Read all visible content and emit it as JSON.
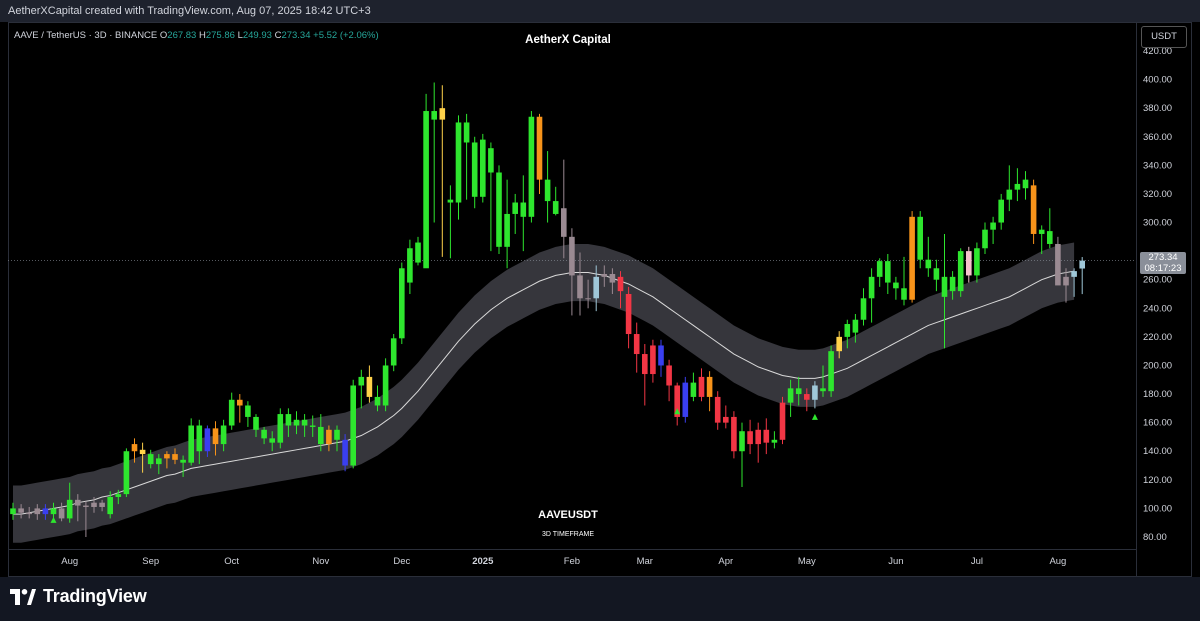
{
  "header": {
    "created_text": "AetherXCapital created with TradingView.com, Aug 07, 2025 18:42 UTC+3"
  },
  "legend": {
    "symbol": "AAVE / TetherUS · 3D · BINANCE",
    "o_label": "O",
    "o_value": "267.83",
    "h_label": "H",
    "h_value": "275.86",
    "l_label": "L",
    "l_value": "249.93",
    "c_label": "C",
    "c_value": "273.34",
    "change": "+5.52 (+2.06%)"
  },
  "watermark": {
    "title": "AetherX Capital",
    "symbol": "AAVEUSDT",
    "timeframe": "3D TIMEFRAME"
  },
  "axis": {
    "unit_button": "USDT",
    "current_price": "273.34",
    "countdown": "08:17:23"
  },
  "brand": {
    "name": "TradingView"
  },
  "colors": {
    "background": "#000000",
    "band_fill": "#3f4046",
    "band_line": "#d9d9d9",
    "bull_green": "#2ee62e",
    "bear_red": "#f23645",
    "orange": "#f7931a",
    "yellow": "#ffd24a",
    "blue": "#3a3ff0",
    "gray": "#9a8a92",
    "light_blue": "#9fc7d8",
    "text": "#d1d4dc"
  },
  "chart_data": {
    "type": "candlestick",
    "symbol": "AAVE / TetherUS",
    "ylim": [
      75,
      430
    ],
    "y_ticks": [
      80,
      100,
      120,
      140,
      160,
      180,
      200,
      220,
      240,
      260,
      280,
      300,
      320,
      340,
      360,
      380,
      400,
      420
    ],
    "y_tick_labels": [
      "80.00",
      "100.00",
      "120.00",
      "140.00",
      "160.00",
      "180.00",
      "200.00",
      "220.00",
      "240.00",
      "260.00",
      "280.00",
      "300.00",
      "320.00",
      "340.00",
      "360.00",
      "380.00",
      "400.00",
      "420.00"
    ],
    "x_ticks": [
      {
        "label": "Aug",
        "index": 7
      },
      {
        "label": "Sep",
        "index": 17
      },
      {
        "label": "Oct",
        "index": 27
      },
      {
        "label": "Nov",
        "index": 38
      },
      {
        "label": "Dec",
        "index": 48
      },
      {
        "label": "2025",
        "index": 58
      },
      {
        "label": "Feb",
        "index": 69
      },
      {
        "label": "Mar",
        "index": 78
      },
      {
        "label": "Apr",
        "index": 88
      },
      {
        "label": "May",
        "index": 98
      },
      {
        "label": "Jun",
        "index": 109
      },
      {
        "label": "Jul",
        "index": 119
      },
      {
        "label": "Aug",
        "index": 129
      }
    ],
    "candles": [
      {
        "o": 96,
        "h": 104,
        "l": 92,
        "c": 100,
        "col": "green"
      },
      {
        "o": 100,
        "h": 103,
        "l": 93,
        "c": 97,
        "col": "gray"
      },
      {
        "o": 97,
        "h": 101,
        "l": 93,
        "c": 96,
        "col": "gray"
      },
      {
        "o": 96,
        "h": 103,
        "l": 92,
        "c": 100,
        "col": "gray"
      },
      {
        "o": 100,
        "h": 103,
        "l": 92,
        "c": 96,
        "col": "blue"
      },
      {
        "o": 96,
        "h": 104,
        "l": 92,
        "c": 100,
        "col": "green"
      },
      {
        "o": 100,
        "h": 104,
        "l": 91,
        "c": 93,
        "col": "gray"
      },
      {
        "o": 93,
        "h": 118,
        "l": 90,
        "c": 106,
        "col": "green"
      },
      {
        "o": 106,
        "h": 110,
        "l": 91,
        "c": 102,
        "col": "gray"
      },
      {
        "o": 102,
        "h": 105,
        "l": 80,
        "c": 101,
        "col": "gray"
      },
      {
        "o": 101,
        "h": 108,
        "l": 97,
        "c": 104,
        "col": "gray"
      },
      {
        "o": 104,
        "h": 106,
        "l": 98,
        "c": 101,
        "col": "gray"
      },
      {
        "o": 96,
        "h": 112,
        "l": 93,
        "c": 108,
        "col": "green"
      },
      {
        "o": 108,
        "h": 113,
        "l": 103,
        "c": 110,
        "col": "green"
      },
      {
        "o": 110,
        "h": 142,
        "l": 108,
        "c": 140,
        "col": "green"
      },
      {
        "o": 140,
        "h": 149,
        "l": 132,
        "c": 145,
        "col": "orange"
      },
      {
        "o": 141,
        "h": 146,
        "l": 125,
        "c": 138,
        "col": "yellow"
      },
      {
        "o": 138,
        "h": 141,
        "l": 128,
        "c": 131,
        "col": "green"
      },
      {
        "o": 131,
        "h": 138,
        "l": 124,
        "c": 135,
        "col": "green"
      },
      {
        "o": 135,
        "h": 140,
        "l": 128,
        "c": 138,
        "col": "orange"
      },
      {
        "o": 138,
        "h": 142,
        "l": 131,
        "c": 134,
        "col": "orange"
      },
      {
        "o": 134,
        "h": 137,
        "l": 122,
        "c": 132,
        "col": "green"
      },
      {
        "o": 132,
        "h": 163,
        "l": 130,
        "c": 158,
        "col": "green"
      },
      {
        "o": 158,
        "h": 162,
        "l": 131,
        "c": 140,
        "col": "green"
      },
      {
        "o": 140,
        "h": 158,
        "l": 136,
        "c": 156,
        "col": "blue"
      },
      {
        "o": 156,
        "h": 161,
        "l": 137,
        "c": 145,
        "col": "orange"
      },
      {
        "o": 145,
        "h": 162,
        "l": 140,
        "c": 158,
        "col": "green"
      },
      {
        "o": 158,
        "h": 181,
        "l": 155,
        "c": 176,
        "col": "green"
      },
      {
        "o": 176,
        "h": 180,
        "l": 160,
        "c": 172,
        "col": "orange"
      },
      {
        "o": 172,
        "h": 175,
        "l": 157,
        "c": 164,
        "col": "green"
      },
      {
        "o": 164,
        "h": 166,
        "l": 150,
        "c": 155,
        "col": "green"
      },
      {
        "o": 155,
        "h": 157,
        "l": 145,
        "c": 149,
        "col": "green"
      },
      {
        "o": 149,
        "h": 154,
        "l": 140,
        "c": 146,
        "col": "green"
      },
      {
        "o": 146,
        "h": 170,
        "l": 142,
        "c": 166,
        "col": "green"
      },
      {
        "o": 166,
        "h": 170,
        "l": 150,
        "c": 158,
        "col": "green"
      },
      {
        "o": 158,
        "h": 168,
        "l": 152,
        "c": 162,
        "col": "green"
      },
      {
        "o": 162,
        "h": 166,
        "l": 150,
        "c": 158,
        "col": "green"
      },
      {
        "o": 158,
        "h": 165,
        "l": 150,
        "c": 157,
        "col": "green"
      },
      {
        "o": 157,
        "h": 166,
        "l": 140,
        "c": 145,
        "col": "green"
      },
      {
        "o": 145,
        "h": 158,
        "l": 140,
        "c": 155,
        "col": "orange"
      },
      {
        "o": 155,
        "h": 158,
        "l": 140,
        "c": 148,
        "col": "green"
      },
      {
        "o": 148,
        "h": 152,
        "l": 126,
        "c": 130,
        "col": "blue"
      },
      {
        "o": 130,
        "h": 190,
        "l": 128,
        "c": 186,
        "col": "green"
      },
      {
        "o": 186,
        "h": 197,
        "l": 170,
        "c": 192,
        "col": "green"
      },
      {
        "o": 192,
        "h": 200,
        "l": 174,
        "c": 178,
        "col": "yellow"
      },
      {
        "o": 178,
        "h": 186,
        "l": 168,
        "c": 172,
        "col": "green"
      },
      {
        "o": 172,
        "h": 205,
        "l": 168,
        "c": 200,
        "col": "green"
      },
      {
        "o": 200,
        "h": 222,
        "l": 196,
        "c": 219,
        "col": "green"
      },
      {
        "o": 219,
        "h": 272,
        "l": 215,
        "c": 268,
        "col": "green"
      },
      {
        "o": 258,
        "h": 288,
        "l": 250,
        "c": 282,
        "col": "green"
      },
      {
        "o": 272,
        "h": 290,
        "l": 270,
        "c": 286,
        "col": "green"
      },
      {
        "o": 268,
        "h": 390,
        "l": 270,
        "c": 378,
        "col": "green"
      },
      {
        "o": 378,
        "h": 398,
        "l": 300,
        "c": 372,
        "col": "green"
      },
      {
        "o": 372,
        "h": 396,
        "l": 276,
        "c": 380,
        "col": "yellow"
      },
      {
        "o": 316,
        "h": 326,
        "l": 275,
        "c": 314,
        "col": "green"
      },
      {
        "o": 314,
        "h": 375,
        "l": 302,
        "c": 370,
        "col": "green"
      },
      {
        "o": 370,
        "h": 376,
        "l": 316,
        "c": 356,
        "col": "green"
      },
      {
        "o": 356,
        "h": 360,
        "l": 310,
        "c": 318,
        "col": "green"
      },
      {
        "o": 318,
        "h": 362,
        "l": 314,
        "c": 358,
        "col": "green"
      },
      {
        "o": 352,
        "h": 356,
        "l": 280,
        "c": 335,
        "col": "green"
      },
      {
        "o": 335,
        "h": 340,
        "l": 278,
        "c": 283,
        "col": "green"
      },
      {
        "o": 283,
        "h": 330,
        "l": 268,
        "c": 306,
        "col": "green"
      },
      {
        "o": 306,
        "h": 320,
        "l": 292,
        "c": 314,
        "col": "green"
      },
      {
        "o": 314,
        "h": 333,
        "l": 280,
        "c": 304,
        "col": "green"
      },
      {
        "o": 304,
        "h": 378,
        "l": 300,
        "c": 374,
        "col": "green"
      },
      {
        "o": 374,
        "h": 376,
        "l": 320,
        "c": 330,
        "col": "orange"
      },
      {
        "o": 330,
        "h": 350,
        "l": 300,
        "c": 315,
        "col": "green"
      },
      {
        "o": 315,
        "h": 325,
        "l": 305,
        "c": 306,
        "col": "green"
      },
      {
        "o": 310,
        "h": 344,
        "l": 275,
        "c": 290,
        "col": "gray"
      },
      {
        "o": 290,
        "h": 296,
        "l": 235,
        "c": 263,
        "col": "gray"
      },
      {
        "o": 263,
        "h": 279,
        "l": 235,
        "c": 247,
        "col": "gray"
      },
      {
        "o": 247,
        "h": 260,
        "l": 240,
        "c": 247,
        "col": "gray"
      },
      {
        "o": 247,
        "h": 270,
        "l": 238,
        "c": 262,
        "col": "light_blue"
      },
      {
        "o": 262,
        "h": 270,
        "l": 255,
        "c": 264,
        "col": "gray"
      },
      {
        "o": 264,
        "h": 268,
        "l": 250,
        "c": 258,
        "col": "gray"
      },
      {
        "o": 262,
        "h": 266,
        "l": 240,
        "c": 252,
        "col": "red"
      },
      {
        "o": 250,
        "h": 255,
        "l": 212,
        "c": 222,
        "col": "red"
      },
      {
        "o": 222,
        "h": 230,
        "l": 195,
        "c": 208,
        "col": "red"
      },
      {
        "o": 208,
        "h": 215,
        "l": 172,
        "c": 194,
        "col": "red"
      },
      {
        "o": 194,
        "h": 218,
        "l": 188,
        "c": 214,
        "col": "red"
      },
      {
        "o": 214,
        "h": 218,
        "l": 192,
        "c": 200,
        "col": "blue"
      },
      {
        "o": 200,
        "h": 204,
        "l": 175,
        "c": 186,
        "col": "red"
      },
      {
        "o": 186,
        "h": 188,
        "l": 158,
        "c": 164,
        "col": "red"
      },
      {
        "o": 164,
        "h": 192,
        "l": 160,
        "c": 188,
        "col": "blue"
      },
      {
        "o": 188,
        "h": 195,
        "l": 175,
        "c": 178,
        "col": "green"
      },
      {
        "o": 178,
        "h": 198,
        "l": 175,
        "c": 192,
        "col": "red"
      },
      {
        "o": 192,
        "h": 196,
        "l": 168,
        "c": 178,
        "col": "orange"
      },
      {
        "o": 178,
        "h": 182,
        "l": 155,
        "c": 160,
        "col": "red"
      },
      {
        "o": 160,
        "h": 172,
        "l": 156,
        "c": 164,
        "col": "red"
      },
      {
        "o": 164,
        "h": 168,
        "l": 135,
        "c": 140,
        "col": "red"
      },
      {
        "o": 140,
        "h": 160,
        "l": 115,
        "c": 154,
        "col": "green"
      },
      {
        "o": 154,
        "h": 162,
        "l": 138,
        "c": 145,
        "col": "red"
      },
      {
        "o": 145,
        "h": 160,
        "l": 132,
        "c": 155,
        "col": "red"
      },
      {
        "o": 155,
        "h": 163,
        "l": 138,
        "c": 146,
        "col": "red"
      },
      {
        "o": 146,
        "h": 154,
        "l": 142,
        "c": 148,
        "col": "green"
      },
      {
        "o": 148,
        "h": 178,
        "l": 145,
        "c": 174,
        "col": "red"
      },
      {
        "o": 174,
        "h": 190,
        "l": 164,
        "c": 184,
        "col": "green"
      },
      {
        "o": 184,
        "h": 192,
        "l": 172,
        "c": 180,
        "col": "green"
      },
      {
        "o": 180,
        "h": 184,
        "l": 168,
        "c": 176,
        "col": "red"
      },
      {
        "o": 176,
        "h": 189,
        "l": 170,
        "c": 186,
        "col": "light_blue"
      },
      {
        "o": 184,
        "h": 200,
        "l": 178,
        "c": 182,
        "col": "green"
      },
      {
        "o": 182,
        "h": 214,
        "l": 178,
        "c": 210,
        "col": "green"
      },
      {
        "o": 210,
        "h": 224,
        "l": 205,
        "c": 220,
        "col": "yellow"
      },
      {
        "o": 220,
        "h": 232,
        "l": 212,
        "c": 229,
        "col": "green"
      },
      {
        "o": 223,
        "h": 236,
        "l": 216,
        "c": 232,
        "col": "green"
      },
      {
        "o": 232,
        "h": 254,
        "l": 228,
        "c": 247,
        "col": "green"
      },
      {
        "o": 247,
        "h": 268,
        "l": 230,
        "c": 262,
        "col": "green"
      },
      {
        "o": 262,
        "h": 275,
        "l": 255,
        "c": 273,
        "col": "green"
      },
      {
        "o": 273,
        "h": 278,
        "l": 250,
        "c": 258,
        "col": "green"
      },
      {
        "o": 258,
        "h": 262,
        "l": 246,
        "c": 254,
        "col": "green"
      },
      {
        "o": 254,
        "h": 276,
        "l": 242,
        "c": 246,
        "col": "green"
      },
      {
        "o": 246,
        "h": 308,
        "l": 244,
        "c": 304,
        "col": "orange"
      },
      {
        "o": 304,
        "h": 308,
        "l": 268,
        "c": 274,
        "col": "green"
      },
      {
        "o": 274,
        "h": 290,
        "l": 262,
        "c": 268,
        "col": "green"
      },
      {
        "o": 268,
        "h": 274,
        "l": 252,
        "c": 260,
        "col": "green"
      },
      {
        "o": 248,
        "h": 292,
        "l": 212,
        "c": 262,
        "col": "green"
      },
      {
        "o": 262,
        "h": 266,
        "l": 246,
        "c": 252,
        "col": "green"
      },
      {
        "o": 252,
        "h": 282,
        "l": 248,
        "c": 280,
        "col": "green"
      },
      {
        "o": 280,
        "h": 283,
        "l": 258,
        "c": 263,
        "col": "pink"
      },
      {
        "o": 263,
        "h": 286,
        "l": 258,
        "c": 282,
        "col": "green"
      },
      {
        "o": 282,
        "h": 300,
        "l": 278,
        "c": 295,
        "col": "green"
      },
      {
        "o": 295,
        "h": 304,
        "l": 285,
        "c": 300,
        "col": "green"
      },
      {
        "o": 300,
        "h": 320,
        "l": 295,
        "c": 316,
        "col": "green"
      },
      {
        "o": 316,
        "h": 340,
        "l": 308,
        "c": 323,
        "col": "green"
      },
      {
        "o": 323,
        "h": 338,
        "l": 315,
        "c": 327,
        "col": "green"
      },
      {
        "o": 324,
        "h": 336,
        "l": 316,
        "c": 330,
        "col": "green"
      },
      {
        "o": 326,
        "h": 330,
        "l": 285,
        "c": 292,
        "col": "orange"
      },
      {
        "o": 292,
        "h": 298,
        "l": 278,
        "c": 295,
        "col": "green"
      },
      {
        "o": 294,
        "h": 310,
        "l": 282,
        "c": 285,
        "col": "green"
      },
      {
        "o": 285,
        "h": 290,
        "l": 258,
        "c": 256,
        "col": "gray"
      },
      {
        "o": 256,
        "h": 268,
        "l": 244,
        "c": 262,
        "col": "gray"
      },
      {
        "o": 262,
        "h": 268,
        "l": 248,
        "c": 266,
        "col": "light_blue"
      },
      {
        "o": 267.83,
        "h": 275.86,
        "l": 249.93,
        "c": 273.34,
        "col": "light_blue"
      }
    ],
    "band": {
      "center": [
        96,
        96,
        97,
        98,
        99,
        100,
        101,
        102,
        104,
        105,
        106,
        108,
        109,
        111,
        113,
        115,
        117,
        119,
        121,
        123,
        124,
        126,
        128,
        129,
        130,
        131,
        132,
        133,
        134,
        135,
        136,
        137,
        138,
        139,
        140,
        141,
        142,
        143,
        144,
        145,
        146,
        147,
        149,
        151,
        154,
        157,
        161,
        165,
        170,
        176,
        182,
        189,
        196,
        203,
        210,
        217,
        223,
        229,
        234,
        239,
        243,
        247,
        250,
        253,
        256,
        259,
        261,
        263,
        264,
        265,
        265,
        265,
        264,
        263,
        261,
        259,
        257,
        254,
        251,
        248,
        244,
        240,
        236,
        232,
        228,
        224,
        220,
        216,
        212,
        208,
        205,
        202,
        199,
        197,
        195,
        193,
        192,
        191,
        191,
        191,
        192,
        194,
        196,
        198,
        201,
        204,
        207,
        210,
        213,
        216,
        219,
        222,
        225,
        228,
        230,
        232,
        234,
        236,
        238,
        240,
        242,
        244,
        246,
        248,
        251,
        254,
        257,
        260,
        262,
        264,
        265,
        266
      ],
      "half_width": 20
    },
    "triangles": [
      {
        "index": 5,
        "value": 92,
        "color": "green"
      },
      {
        "index": 82,
        "value": 168,
        "color": "green"
      },
      {
        "index": 99,
        "value": 164,
        "color": "green"
      }
    ],
    "current_price": 273.34
  }
}
